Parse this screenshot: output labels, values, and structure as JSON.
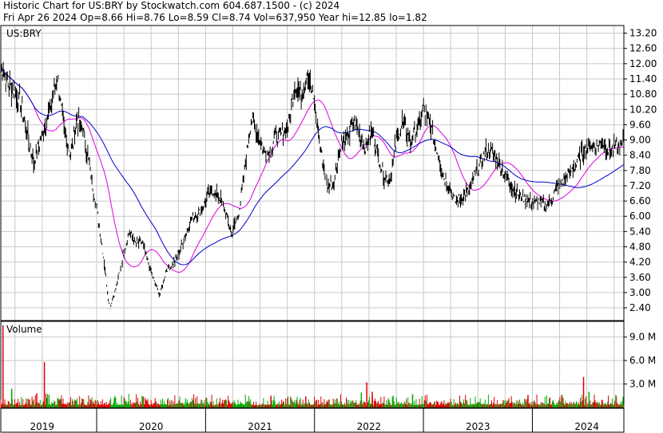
{
  "header": {
    "line1": "Historic Chart for US:BRY by Stockwatch.com 604.687.1500 - (c) 2024",
    "line2": "Fri Apr 26 2024   Op=8.66  Hi=8.76  Lo=8.59  Cl=8.74  Vol=637,950  Year hi=12.85  lo=1.82"
  },
  "chart_data": [
    {
      "type": "line",
      "title": "",
      "legend": "US:BRY",
      "price_ticks": [
        2.4,
        3.0,
        3.6,
        4.2,
        4.8,
        5.4,
        6.0,
        6.6,
        7.2,
        7.8,
        8.4,
        9.0,
        9.6,
        10.2,
        10.8,
        11.4,
        12.0,
        12.6,
        13.2
      ],
      "price_tick_labels": [
        "2.40",
        "3.00",
        "3.60",
        "4.20",
        "4.80",
        "5.40",
        "6.00",
        "6.60",
        "7.20",
        "7.80",
        "8.40",
        "9.00",
        "9.60",
        "10.20",
        "10.80",
        "11.40",
        "12.00",
        "12.60",
        "13.20"
      ],
      "ylim": [
        1.9,
        13.5
      ],
      "xlim": [
        2018.62,
        2024.34
      ],
      "year_labels": [
        {
          "label": "2019",
          "x": 2019.0
        },
        {
          "label": "2020",
          "x": 2020.0
        },
        {
          "label": "2021",
          "x": 2021.0
        },
        {
          "label": "2022",
          "x": 2022.0
        },
        {
          "label": "2023",
          "x": 2023.0
        },
        {
          "label": "2024",
          "x": 2024.0
        }
      ],
      "year_boundaries": [
        2019.5,
        2020.5,
        2021.5,
        2022.5,
        2023.5
      ],
      "grid": true,
      "price_series": {
        "name": "US:BRY",
        "x": [
          2018.62,
          2018.68,
          2018.74,
          2018.8,
          2018.86,
          2018.92,
          2018.97,
          2019.03,
          2019.08,
          2019.14,
          2019.2,
          2019.26,
          2019.32,
          2019.38,
          2019.44,
          2019.5,
          2019.56,
          2019.62,
          2019.68,
          2019.74,
          2019.8,
          2019.86,
          2019.92,
          2019.97,
          2020.03,
          2020.08,
          2020.14,
          2020.2,
          2020.26,
          2020.32,
          2020.38,
          2020.44,
          2020.5,
          2020.56,
          2020.62,
          2020.68,
          2020.74,
          2020.8,
          2020.86,
          2020.92,
          2020.97,
          2021.03,
          2021.08,
          2021.14,
          2021.2,
          2021.26,
          2021.32,
          2021.38,
          2021.44,
          2021.5,
          2021.56,
          2021.62,
          2021.68,
          2021.74,
          2021.8,
          2021.86,
          2021.92,
          2021.97,
          2022.03,
          2022.08,
          2022.14,
          2022.2,
          2022.26,
          2022.32,
          2022.38,
          2022.44,
          2022.5,
          2022.56,
          2022.62,
          2022.68,
          2022.74,
          2022.8,
          2022.86,
          2022.92,
          2022.97,
          2023.03,
          2023.08,
          2023.14,
          2023.2,
          2023.26,
          2023.32,
          2023.38,
          2023.44,
          2023.5,
          2023.56,
          2023.62,
          2023.68,
          2023.74,
          2023.8,
          2023.86,
          2023.92,
          2023.97,
          2024.03,
          2024.08,
          2024.14,
          2024.2,
          2024.26,
          2024.32
        ],
        "close": [
          11.9,
          11.3,
          10.9,
          10.5,
          9.3,
          8.1,
          8.8,
          9.6,
          10.4,
          11.5,
          9.4,
          8.4,
          9.8,
          9.3,
          7.8,
          6.3,
          4.5,
          2.4,
          3.2,
          4.4,
          5.4,
          4.9,
          5.0,
          4.2,
          3.4,
          2.9,
          3.9,
          4.1,
          4.6,
          5.3,
          6.0,
          6.1,
          6.6,
          7.0,
          6.8,
          6.2,
          5.3,
          6.0,
          7.8,
          9.9,
          9.3,
          8.6,
          8.4,
          9.1,
          9.2,
          9.6,
          11.1,
          10.8,
          11.8,
          10.3,
          8.5,
          7.2,
          7.4,
          8.8,
          9.0,
          9.8,
          9.1,
          8.7,
          9.4,
          8.4,
          7.6,
          7.5,
          9.2,
          9.7,
          8.9,
          9.4,
          10.2,
          9.6,
          8.7,
          7.6,
          7.1,
          6.5,
          6.8,
          7.0,
          7.6,
          8.1,
          8.6,
          8.5,
          8.0,
          7.5,
          7.1,
          6.8,
          6.7,
          6.5,
          6.6,
          6.4,
          6.7,
          7.2,
          7.5,
          7.8,
          8.2,
          8.6,
          8.8,
          8.7,
          8.9,
          8.6,
          8.7,
          8.74
        ]
      },
      "moving_averages": [
        {
          "color": "#dd00dd",
          "period": 20
        },
        {
          "color": "#0000cc",
          "period": 50
        }
      ]
    },
    {
      "type": "bar",
      "title": "Volume",
      "tick_values": [
        3000000,
        6000000,
        9000000
      ],
      "tick_labels": [
        "3.0 M",
        "6.0 M",
        "9.0 M"
      ],
      "ylim": [
        0,
        11000000
      ],
      "spikes": [
        {
          "x": 2018.64,
          "value": 10500000
        },
        {
          "x": 2018.72,
          "value": 2400000
        },
        {
          "x": 2018.95,
          "value": 1800000
        },
        {
          "x": 2019.02,
          "value": 5800000
        },
        {
          "x": 2019.05,
          "value": 1700000
        },
        {
          "x": 2021.1,
          "value": 1500000
        },
        {
          "x": 2021.42,
          "value": 1400000
        },
        {
          "x": 2021.93,
          "value": 1900000
        },
        {
          "x": 2021.98,
          "value": 3200000
        },
        {
          "x": 2022.03,
          "value": 2000000
        },
        {
          "x": 2022.4,
          "value": 1700000
        },
        {
          "x": 2023.46,
          "value": 1600000
        },
        {
          "x": 2023.97,
          "value": 3900000
        },
        {
          "x": 2024.02,
          "value": 2000000
        }
      ],
      "up_color": "#00aa00",
      "down_color": "#dd0000"
    }
  ],
  "colors": {
    "price": "#000000",
    "grid": "#c8c8c8",
    "background": "#ffffff"
  }
}
